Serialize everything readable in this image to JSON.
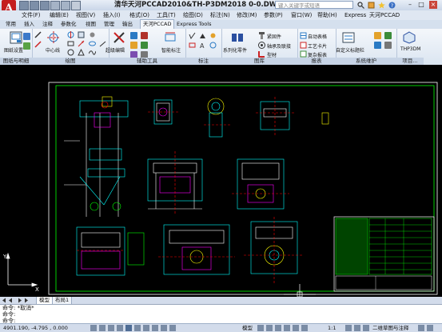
{
  "title_bar": {
    "app_title": "清华天河PCCAD2010&TH-P3DM2018  0-0.DWG",
    "search_placeholder": "键入关键字或短语"
  },
  "menu": [
    "文件(F)",
    "编辑(E)",
    "视图(V)",
    "插入(I)",
    "格式(O)",
    "工具(T)",
    "绘图(D)",
    "标注(N)",
    "修改(M)",
    "参数(P)",
    "窗口(W)",
    "帮助(H)",
    "Express",
    "天河PCCAD"
  ],
  "ribbon_tabs": [
    "常用",
    "插入",
    "注释",
    "参数化",
    "视图",
    "管理",
    "输出",
    "天河PCCAD",
    "Express Tools"
  ],
  "active_tab": "天河PCCAD",
  "ribbon": {
    "tuzhi_btn": "图纸设置",
    "centerline_btn": "中心线",
    "super_edit_btn": "超级编辑",
    "smart_dim_btn": "智能标注",
    "serial_btn": "系列化零件",
    "std_parts_btn": "紧固件",
    "bearing_btn": "轴承及联接",
    "profile_btn": "型材",
    "auto_table_btn": "自动表格",
    "process_card_btn": "工艺卡片",
    "bom_btn": "复杂报表",
    "custom_menu_btn": "自定义标题栏",
    "p3dm_btn": "THP3DM",
    "panel_labels": [
      "图纸与明细",
      "绘图",
      "辅助工具",
      "标注",
      "图库",
      "报表",
      "系统维护",
      "项目..."
    ]
  },
  "layout_tabs": [
    "模型",
    "布局1"
  ],
  "command": {
    "line1": "命令: *取消*",
    "line2": "命令:",
    "line3": "命令:"
  },
  "status": {
    "coords": "4901.190, -4.795 , 0.000",
    "model_label": "模型",
    "scale": "1:1",
    "workspace": "二维草图与注释"
  },
  "colors": {
    "canvas_bg": "#000000",
    "cad_cyan": "#00ffff",
    "cad_green": "#00ff00",
    "cad_yellow": "#ffff00",
    "cad_magenta": "#ff00ff",
    "cad_red": "#ff0000"
  }
}
